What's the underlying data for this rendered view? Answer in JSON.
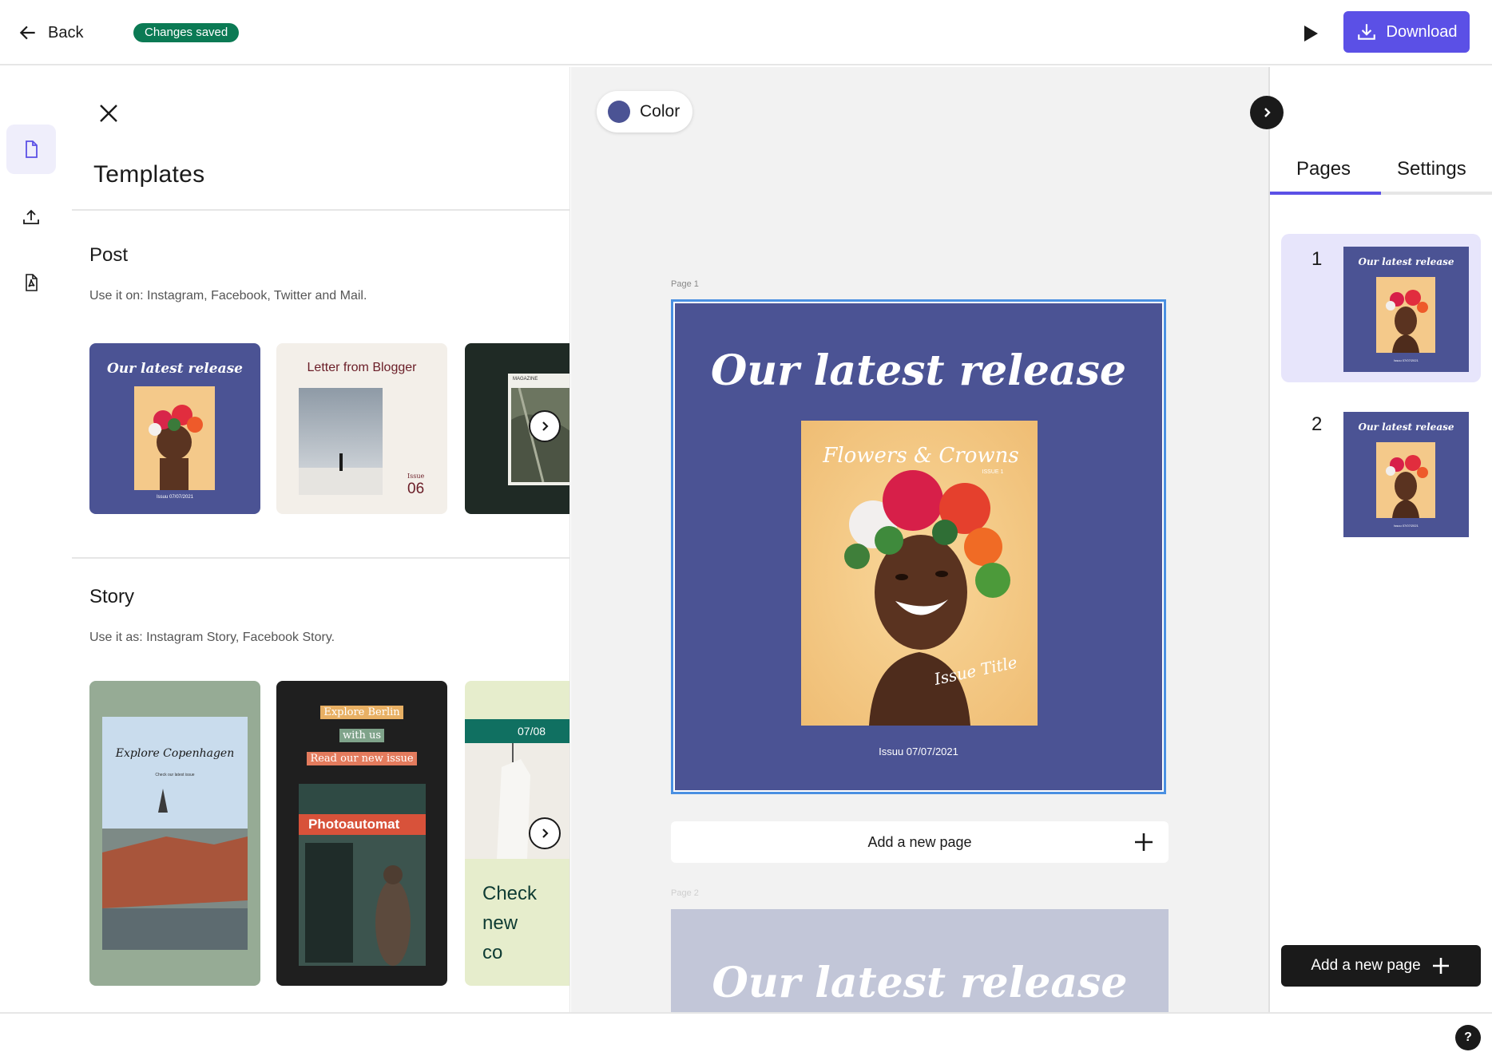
{
  "topbar": {
    "back_label": "Back",
    "saved_badge": "Changes saved",
    "download_label": "Download"
  },
  "templates_panel": {
    "title": "Templates",
    "post": {
      "title": "Post",
      "description": "Use it on: Instagram, Facebook, Twitter and Mail.",
      "cards": [
        {
          "headline": "Our latest release",
          "caption": "Issuu 07/07/2021",
          "script": "Flowers & Crowns"
        },
        {
          "headline": "Letter from Blogger",
          "issue_label": "Issue",
          "issue_number": "06"
        },
        {
          "headline": "MAGAZINE"
        }
      ]
    },
    "story": {
      "title": "Story",
      "description": "Use it as: Instagram Story, Facebook Story.",
      "cards": [
        {
          "headline": "Explore Copenhagen",
          "subline": "Check our latest issue"
        },
        {
          "lines": [
            "Explore Berlin",
            "with us",
            "Read our new issue"
          ],
          "sign": "Photoautomat"
        },
        {
          "date": "07/08",
          "text": "Check new co"
        }
      ]
    }
  },
  "canvas": {
    "color_label": "Color",
    "color_value": "#4b5394",
    "page1_label": "Page 1",
    "page2_label": "Page 2",
    "headline": "Our latest release",
    "cover_script": "Flowers & Crowns",
    "cover_issue": "ISSUE 1",
    "cover_signature": "Issue Title",
    "caption": "Issuu 07/07/2021",
    "add_page_label": "Add a new page"
  },
  "right_panel": {
    "tabs": [
      "Pages",
      "Settings"
    ],
    "active_tab": "Pages",
    "pages": [
      {
        "number": "1",
        "headline": "Our latest release",
        "caption": "Issuu 07/07/2021"
      },
      {
        "number": "2",
        "headline": "Our latest release",
        "caption": "Issuu 07/07/2021"
      }
    ],
    "add_page_label": "Add a new page"
  },
  "bottombar": {
    "help_label": "?"
  },
  "colors": {
    "accent": "#5b50e6",
    "page_blue": "#4b5394",
    "saved_green": "#0b7a54"
  }
}
